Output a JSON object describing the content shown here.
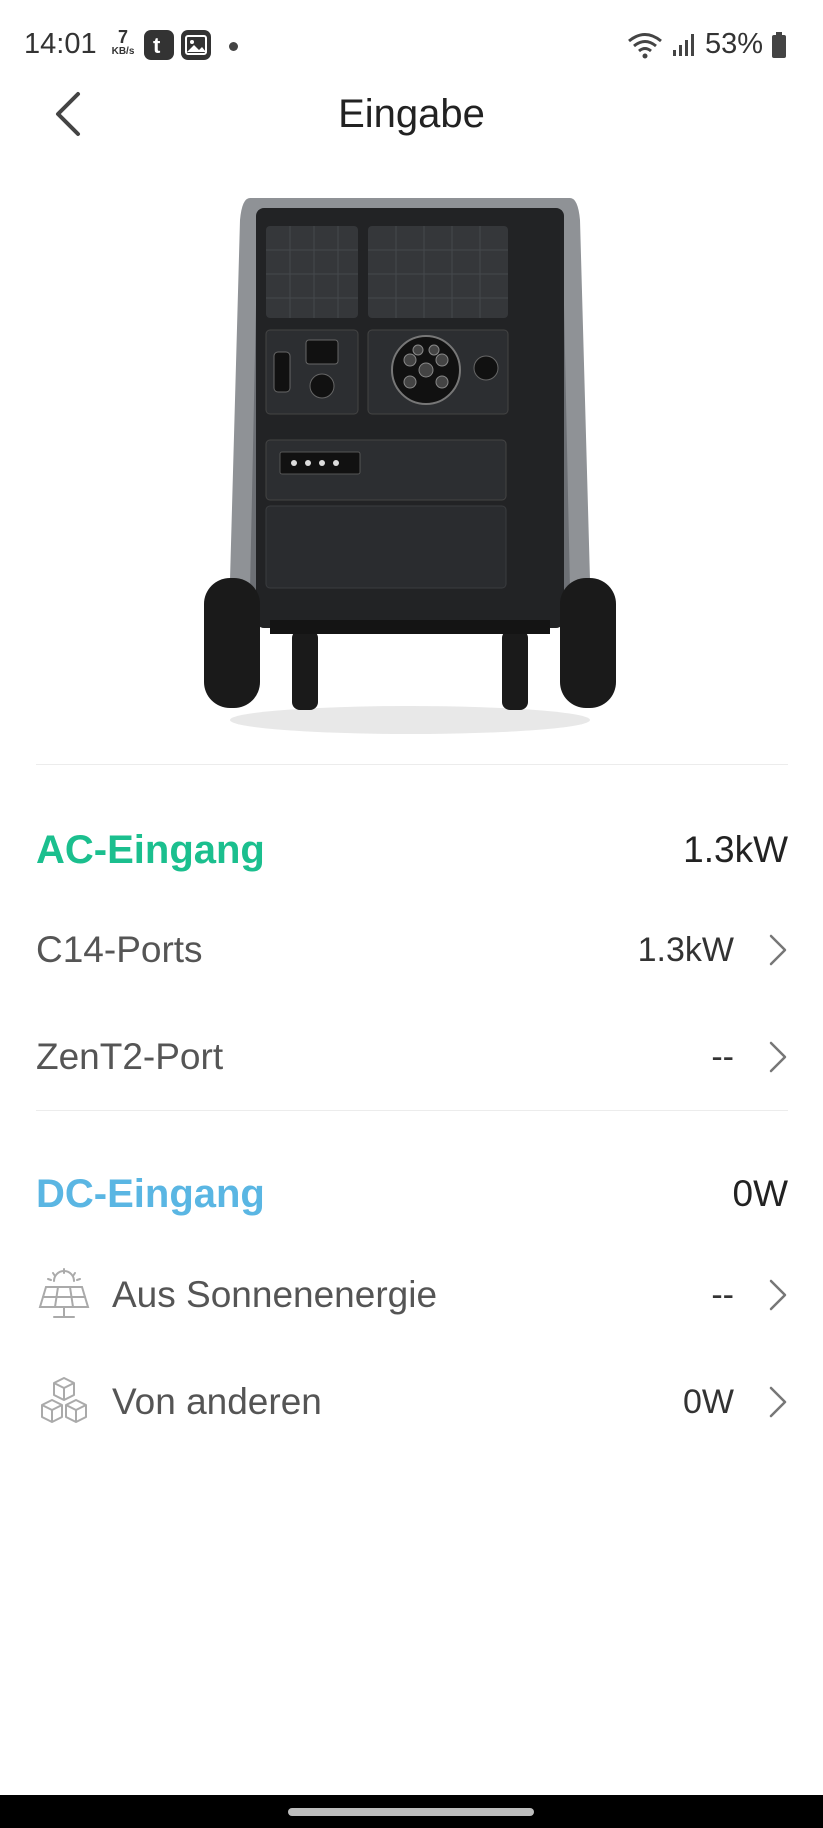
{
  "status_bar": {
    "time": "14:01",
    "net_speed_value": "7",
    "net_speed_unit": "KB/s",
    "battery_text": "53%"
  },
  "header": {
    "title": "Eingabe"
  },
  "ac_input": {
    "title": "AC-Eingang",
    "value": "1.3kW",
    "color": "#1bbf8e",
    "items": [
      {
        "label": "C14-Ports",
        "value": "1.3kW"
      },
      {
        "label": "ZenT2-Port",
        "value": "--"
      }
    ]
  },
  "dc_input": {
    "title": "DC-Eingang",
    "value": "0W",
    "color": "#5ab6e3",
    "items": [
      {
        "label": "Aus Sonnenenergie",
        "value": "--",
        "icon": "solar-panel-icon"
      },
      {
        "label": "Von anderen",
        "value": "0W",
        "icon": "cubes-icon"
      }
    ]
  }
}
